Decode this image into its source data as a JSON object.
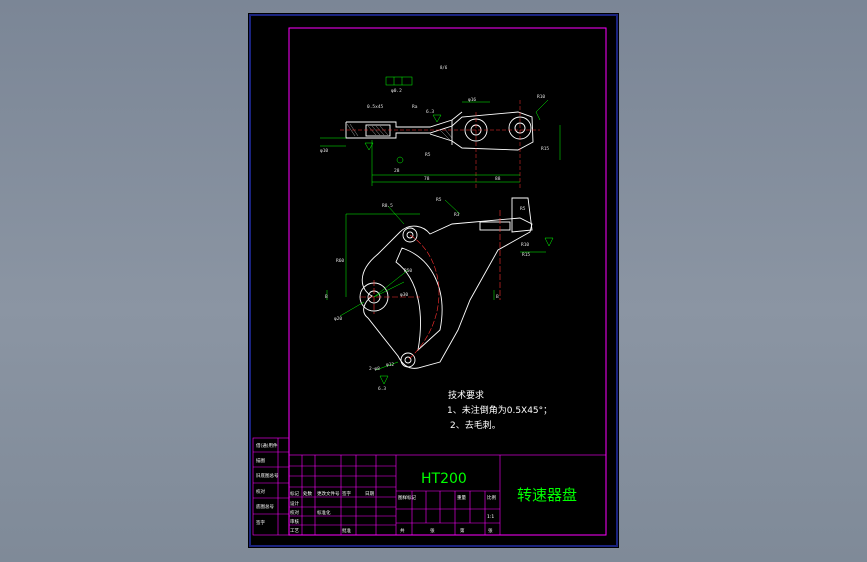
{
  "drawing": {
    "tech_title": "技术要求",
    "tech_notes": [
      "1、未注倒角为0.5X45°；",
      "2、去毛刺。"
    ],
    "material": "HT200",
    "part_name": "转速器盘",
    "scale": "1:1",
    "small_title_center": "8/6"
  },
  "dimensions": {
    "top_view": [
      "0.5x45",
      "φ10",
      "Ra",
      "6.3",
      "R10",
      "φ16",
      "R15",
      "R5",
      "28",
      "78",
      "88",
      "φ0.2"
    ],
    "front_view": [
      "R8.5",
      "R5",
      "R3",
      "R5",
      "R10",
      "R15",
      "φ20",
      "φ30",
      "R50",
      "R60",
      "2-φ8",
      "φ12",
      "6.3",
      "B"
    ]
  },
  "title_block": {
    "left_column": [
      "借(通)用件",
      "描图",
      "旧底图总号",
      "描图",
      "校对",
      "底图总号",
      "签字",
      "日期"
    ],
    "bottom_rows": [
      "标记",
      "处数",
      "更改文件号",
      "签字",
      "日期",
      "设计",
      "校对",
      "审核",
      "工艺",
      "标准化",
      "批准"
    ],
    "right_block": [
      "图样标记",
      "重量",
      "比例",
      "共",
      "张",
      "第",
      "张"
    ]
  },
  "colors": {
    "background": "#000000",
    "frame_outer": "#1a237e",
    "frame_inner": "#ff00ff",
    "text_accent": "#00ff00",
    "part_outline": "#ffffff",
    "center_line": "#ff3030"
  }
}
